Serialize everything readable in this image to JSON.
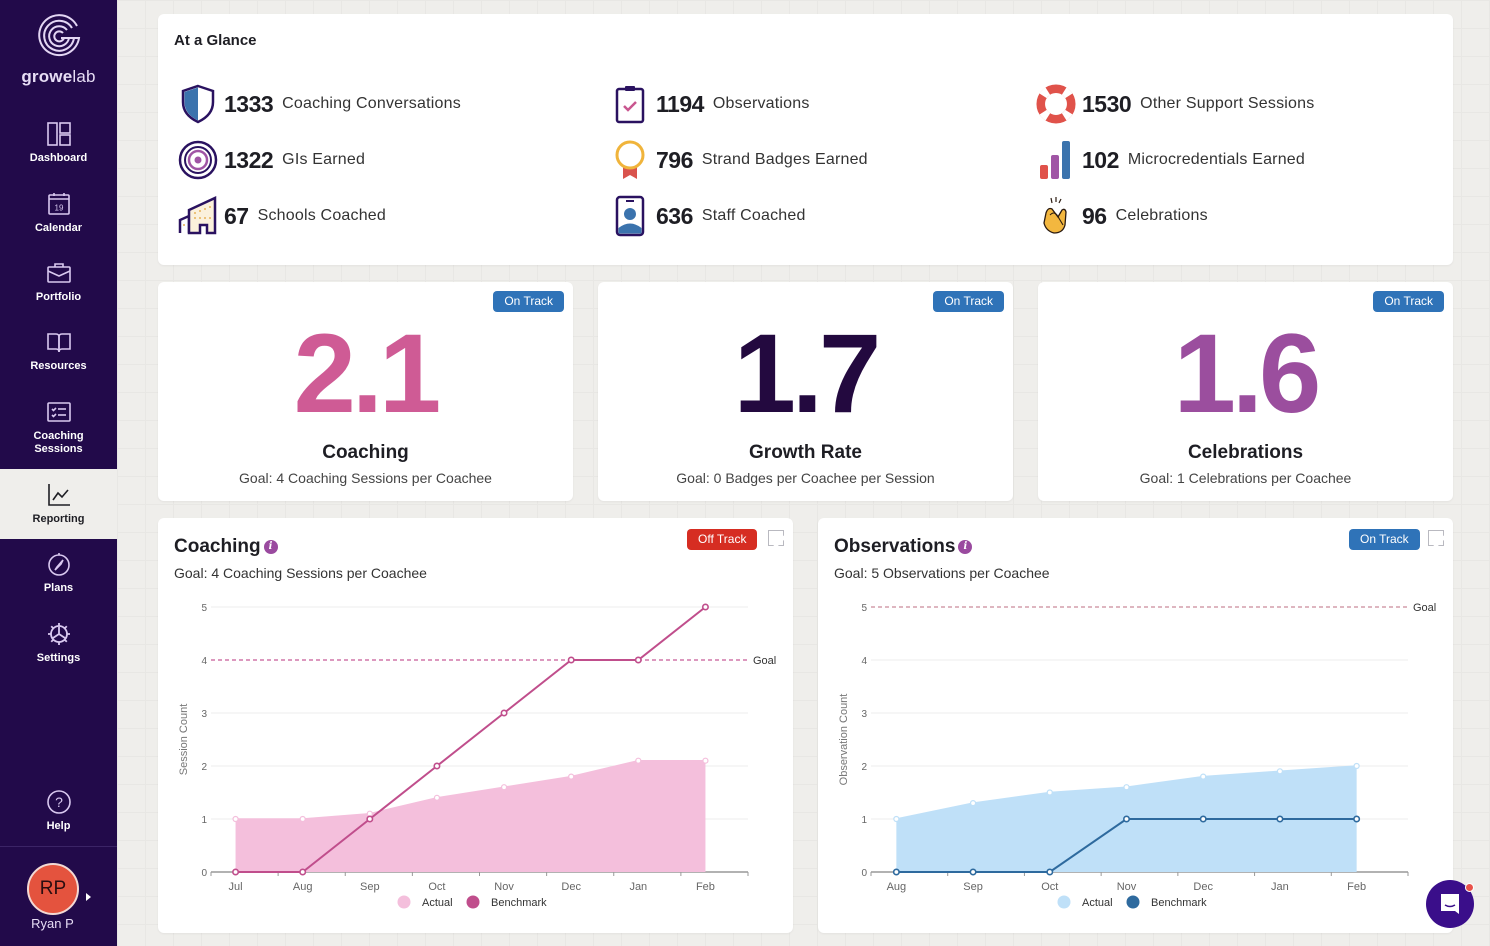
{
  "app": {
    "brand_bold": "growe",
    "brand_light": "lab"
  },
  "sidebar": {
    "items": [
      {
        "label": "Dashboard",
        "icon": "dashboard-icon"
      },
      {
        "label": "Calendar",
        "icon": "calendar-icon",
        "icon_text": "19"
      },
      {
        "label": "Portfolio",
        "icon": "briefcase-icon"
      },
      {
        "label": "Resources",
        "icon": "book-icon"
      },
      {
        "label": "Coaching Sessions",
        "label_line1": "Coaching",
        "label_line2": "Sessions",
        "icon": "checklist-icon"
      },
      {
        "label": "Reporting",
        "icon": "line-chart-icon",
        "active": true
      },
      {
        "label": "Plans",
        "icon": "compass-icon"
      },
      {
        "label": "Settings",
        "icon": "gear-icon"
      },
      {
        "label": "Help",
        "icon": "help-icon"
      }
    ],
    "user": {
      "initials": "RP",
      "name": "Ryan P"
    }
  },
  "glance": {
    "title": "At a Glance",
    "stats": [
      {
        "value": "1333",
        "label": "Coaching Conversations",
        "icon": "shield-icon"
      },
      {
        "value": "1194",
        "label": "Observations",
        "icon": "clipboard-check-icon"
      },
      {
        "value": "1530",
        "label": "Other Support Sessions",
        "icon": "lifebuoy-icon"
      },
      {
        "value": "1322",
        "label": "GIs Earned",
        "icon": "target-icon"
      },
      {
        "value": "796",
        "label": "Strand Badges Earned",
        "icon": "medal-icon"
      },
      {
        "value": "102",
        "label": "Microcredentials Earned",
        "icon": "bar-chart-icon"
      },
      {
        "value": "67",
        "label": "Schools Coached",
        "icon": "buildings-icon"
      },
      {
        "value": "636",
        "label": "Staff Coached",
        "icon": "id-badge-icon"
      },
      {
        "value": "96",
        "label": "Celebrations",
        "icon": "clapping-hands-icon"
      }
    ]
  },
  "kpis": [
    {
      "value": "2.1",
      "title": "Coaching",
      "goal": "Goal: 4 Coaching Sessions per Coachee",
      "status": "On Track",
      "color": "#cf5b95"
    },
    {
      "value": "1.7",
      "title": "Growth Rate",
      "goal": "Goal: 0 Badges per Coachee per Session",
      "status": "On Track",
      "color": "#23093f"
    },
    {
      "value": "1.6",
      "title": "Celebrations",
      "goal": "Goal: 1 Celebrations per Coachee",
      "status": "On Track",
      "color": "#9b4e9e"
    }
  ],
  "colors": {
    "on_track": "#2f73b8",
    "off_track": "#d62d22",
    "sidebar": "#220a4a"
  },
  "chart_data": [
    {
      "type": "area",
      "title": "Coaching",
      "subtitle": "Goal: 4 Coaching Sessions per Coachee",
      "status": "Off Track",
      "ylabel": "Session Count",
      "xlabel": "",
      "categories": [
        "Jul",
        "Aug",
        "Sep",
        "Oct",
        "Nov",
        "Dec",
        "Jan",
        "Feb"
      ],
      "series": [
        {
          "name": "Actual",
          "kind": "area",
          "color": "#f4bfdc",
          "values": [
            1,
            1,
            1.1,
            1.4,
            1.6,
            1.8,
            2.1,
            2.1
          ]
        },
        {
          "name": "Benchmark",
          "kind": "line",
          "color": "#c04e8c",
          "values": [
            0,
            0,
            1,
            2,
            3,
            4,
            4,
            5
          ]
        }
      ],
      "goal": {
        "value": 4,
        "label": "Goal",
        "color": "#c85a97"
      },
      "ylim": [
        0,
        5
      ],
      "yticks": [
        0,
        1,
        2,
        3,
        4,
        5
      ],
      "grid": true,
      "legend": "bottom"
    },
    {
      "type": "area",
      "title": "Observations",
      "subtitle": "Goal: 5 Observations per Coachee",
      "status": "On Track",
      "ylabel": "Observation Count",
      "xlabel": "",
      "categories": [
        "Aug",
        "Sep",
        "Oct",
        "Nov",
        "Dec",
        "Jan",
        "Feb"
      ],
      "series": [
        {
          "name": "Actual",
          "kind": "area",
          "color": "#bfe0f8",
          "values": [
            1,
            1.3,
            1.5,
            1.6,
            1.8,
            1.9,
            2.0
          ]
        },
        {
          "name": "Benchmark",
          "kind": "line",
          "color": "#2e6a9e",
          "values": [
            0,
            0,
            0,
            1,
            1,
            1,
            1
          ]
        }
      ],
      "goal": {
        "value": 5,
        "label": "Goal",
        "color": "#c98a9a"
      },
      "ylim": [
        0,
        5
      ],
      "yticks": [
        0,
        1,
        2,
        3,
        4,
        5
      ],
      "grid": true,
      "legend": "bottom"
    }
  ]
}
